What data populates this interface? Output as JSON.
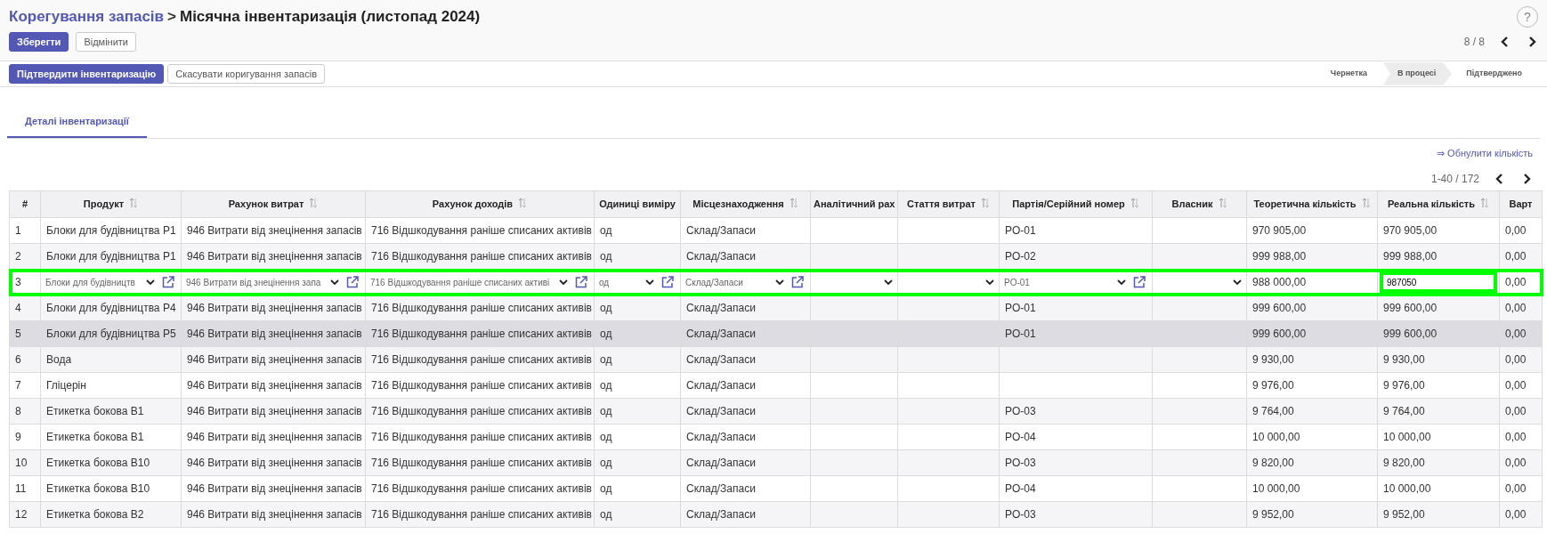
{
  "breadcrumb": {
    "parent": "Корегування запасів",
    "separator": ">",
    "title": "Місячна інвентаризація (листопад 2024)"
  },
  "help": "?",
  "form_buttons": [
    {
      "label": "Зберегти",
      "kind": "primary"
    },
    {
      "label": "Відмінити",
      "kind": "secondary"
    }
  ],
  "record_pager": "8 / 8",
  "action_buttons": [
    {
      "label": "Підтвердити інвентаризацію",
      "kind": "primary"
    },
    {
      "label": "Скасувати коригування запасів",
      "kind": "secondary"
    }
  ],
  "stages": [
    {
      "label": "Чернетка",
      "selected": false
    },
    {
      "label": "В процесі",
      "selected": true
    },
    {
      "label": "Підтверджено",
      "selected": false
    }
  ],
  "tabs": [
    {
      "label": "Деталі інвентаризації",
      "selected": true
    }
  ],
  "reset_link": "⇒ Обнулити кількість",
  "table": {
    "pager": "1-40 / 172",
    "columns": [
      {
        "label": "#",
        "sortable": false
      },
      {
        "label": "Продукт",
        "sortable": true
      },
      {
        "label": "Рахунок витрат",
        "sortable": true
      },
      {
        "label": "Рахунок доходів",
        "sortable": true
      },
      {
        "label": "Одиниці виміру",
        "sortable": false
      },
      {
        "label": "Місцезнаходження",
        "sortable": true
      },
      {
        "label": "Аналітичний рах",
        "sortable": false
      },
      {
        "label": "Стаття витрат",
        "sortable": true
      },
      {
        "label": "Партія/Серійний номер",
        "sortable": true
      },
      {
        "label": "Власник",
        "sortable": true
      },
      {
        "label": "Теоретична кількість",
        "sortable": true
      },
      {
        "label": "Реальна кількість",
        "sortable": true
      },
      {
        "label": "Варт",
        "sortable": false
      }
    ],
    "rows": [
      {
        "editing": false,
        "selected": false,
        "highlight": false,
        "cells": [
          "1",
          "Блоки для будівництва Р1",
          "946 Витрати від знецінення запасів",
          "716 Відшкодування раніше списаних активів",
          "од",
          "Склад/Запаси",
          null,
          null,
          "PO-01",
          null,
          "970 905,00",
          "970 905,00",
          "0,00"
        ]
      },
      {
        "editing": false,
        "selected": false,
        "highlight": false,
        "cells": [
          "2",
          "Блоки для будівництва Р1",
          "946 Витрати від знецінення запасів",
          "716 Відшкодування раніше списаних активів",
          "од",
          "Склад/Запаси",
          null,
          null,
          "PO-02",
          null,
          "999 988,00",
          "999 988,00",
          "0,00"
        ]
      },
      {
        "editing": true,
        "selected": false,
        "highlight": true,
        "fields": [
          {
            "kind": "text",
            "value": "3"
          },
          {
            "kind": "select",
            "value": "Блоки для будівництв",
            "link": true
          },
          {
            "kind": "select",
            "value": "946 Витрати від знецінення запа",
            "link": true
          },
          {
            "kind": "select",
            "value": "716 Відшкодування раніше списаних активі",
            "link": true
          },
          {
            "kind": "select",
            "value": "од",
            "link": true
          },
          {
            "kind": "select",
            "value": "Склад/Запаси",
            "link": true
          },
          {
            "kind": "select",
            "link": false
          },
          {
            "kind": "select",
            "link": false
          },
          {
            "kind": "select",
            "value": "PO-01",
            "link": true
          },
          {
            "kind": "select",
            "link": false
          },
          {
            "kind": "text",
            "value": "988 000,00"
          },
          {
            "kind": "input",
            "value": "987050",
            "highlight": true
          },
          {
            "kind": "text",
            "value": "0,00"
          }
        ]
      },
      {
        "editing": false,
        "selected": false,
        "highlight": false,
        "cells": [
          "4",
          "Блоки для будівництва Р4",
          "946 Витрати від знецінення запасів",
          "716 Відшкодування раніше списаних активів",
          "од",
          "Склад/Запаси",
          null,
          null,
          "PO-01",
          null,
          "999 600,00",
          "999 600,00",
          "0,00"
        ]
      },
      {
        "editing": false,
        "selected": true,
        "highlight": false,
        "cells": [
          "5",
          "Блоки для будівництва Р5",
          "946 Витрати від знецінення запасів",
          "716 Відшкодування раніше списаних активів",
          "од",
          "Склад/Запаси",
          null,
          null,
          "PO-01",
          null,
          "999 600,00",
          "999 600,00",
          "0,00"
        ]
      },
      {
        "editing": false,
        "selected": false,
        "highlight": false,
        "cells": [
          "6",
          "Вода",
          "946 Витрати від знецінення запасів",
          "716 Відшкодування раніше списаних активів",
          "од",
          "Склад/Запаси",
          null,
          null,
          null,
          null,
          "9 930,00",
          "9 930,00",
          "0,00"
        ]
      },
      {
        "editing": false,
        "selected": false,
        "highlight": false,
        "cells": [
          "7",
          "Гліцерін",
          "946 Витрати від знецінення запасів",
          "716 Відшкодування раніше списаних активів",
          "од",
          "Склад/Запаси",
          null,
          null,
          null,
          null,
          "9 976,00",
          "9 976,00",
          "0,00"
        ]
      },
      {
        "editing": false,
        "selected": false,
        "highlight": false,
        "cells": [
          "8",
          "Етикетка бокова B1",
          "946 Витрати від знецінення запасів",
          "716 Відшкодування раніше списаних активів",
          "од",
          "Склад/Запаси",
          null,
          null,
          "PO-03",
          null,
          "9 764,00",
          "9 764,00",
          "0,00"
        ]
      },
      {
        "editing": false,
        "selected": false,
        "highlight": false,
        "cells": [
          "9",
          "Етикетка бокова B1",
          "946 Витрати від знецінення запасів",
          "716 Відшкодування раніше списаних активів",
          "од",
          "Склад/Запаси",
          null,
          null,
          "PO-04",
          null,
          "10 000,00",
          "10 000,00",
          "0,00"
        ]
      },
      {
        "editing": false,
        "selected": false,
        "highlight": false,
        "cells": [
          "10",
          "Етикетка бокова B10",
          "946 Витрати від знецінення запасів",
          "716 Відшкодування раніше списаних активів",
          "од",
          "Склад/Запаси",
          null,
          null,
          "PO-03",
          null,
          "9 820,00",
          "9 820,00",
          "0,00"
        ]
      },
      {
        "editing": false,
        "selected": false,
        "highlight": false,
        "cells": [
          "11",
          "Етикетка бокова B10",
          "946 Витрати від знецінення запасів",
          "716 Відшкодування раніше списаних активів",
          "од",
          "Склад/Запаси",
          null,
          null,
          "PO-04",
          null,
          "10 000,00",
          "10 000,00",
          "0,00"
        ]
      },
      {
        "editing": false,
        "selected": false,
        "highlight": false,
        "cells": [
          "12",
          "Етикетка бокова B2",
          "946 Витрати від знецінення запасів",
          "716 Відшкодування раніше списаних активів",
          "од",
          "Склад/Запаси",
          null,
          null,
          "PO-03",
          null,
          "9 952,00",
          "9 952,00",
          "0,00"
        ]
      }
    ]
  }
}
